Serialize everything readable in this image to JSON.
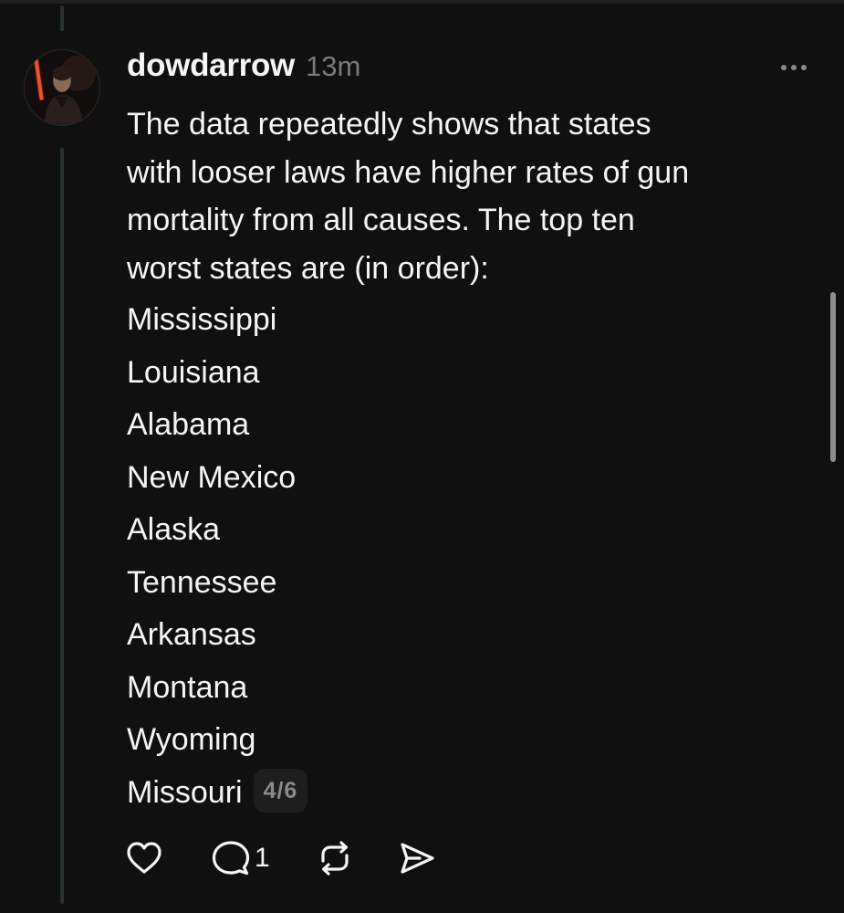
{
  "post": {
    "username": "dowdarrow",
    "timestamp": "13m",
    "body_lines": [
      "The data repeatedly shows that states",
      "with looser laws have higher rates of gun",
      "mortality from all causes. The top ten",
      "worst states are (in order):"
    ],
    "states": [
      "Mississippi",
      "Louisiana",
      "Alabama",
      "New Mexico",
      "Alaska",
      "Tennessee",
      "Arkansas",
      "Montana",
      "Wyoming",
      "Missouri"
    ],
    "page_indicator": "4/6"
  },
  "actions": {
    "like_icon": "heart-icon",
    "reply_icon": "comment-icon",
    "reply_count": "1",
    "repost_icon": "repost-icon",
    "share_icon": "send-icon"
  },
  "colors": {
    "background": "#101010",
    "text_primary": "#f3f5f7",
    "text_secondary": "#7a7a7a",
    "thread_line": "#2b3330",
    "badge_background": "#1e1e1e"
  }
}
